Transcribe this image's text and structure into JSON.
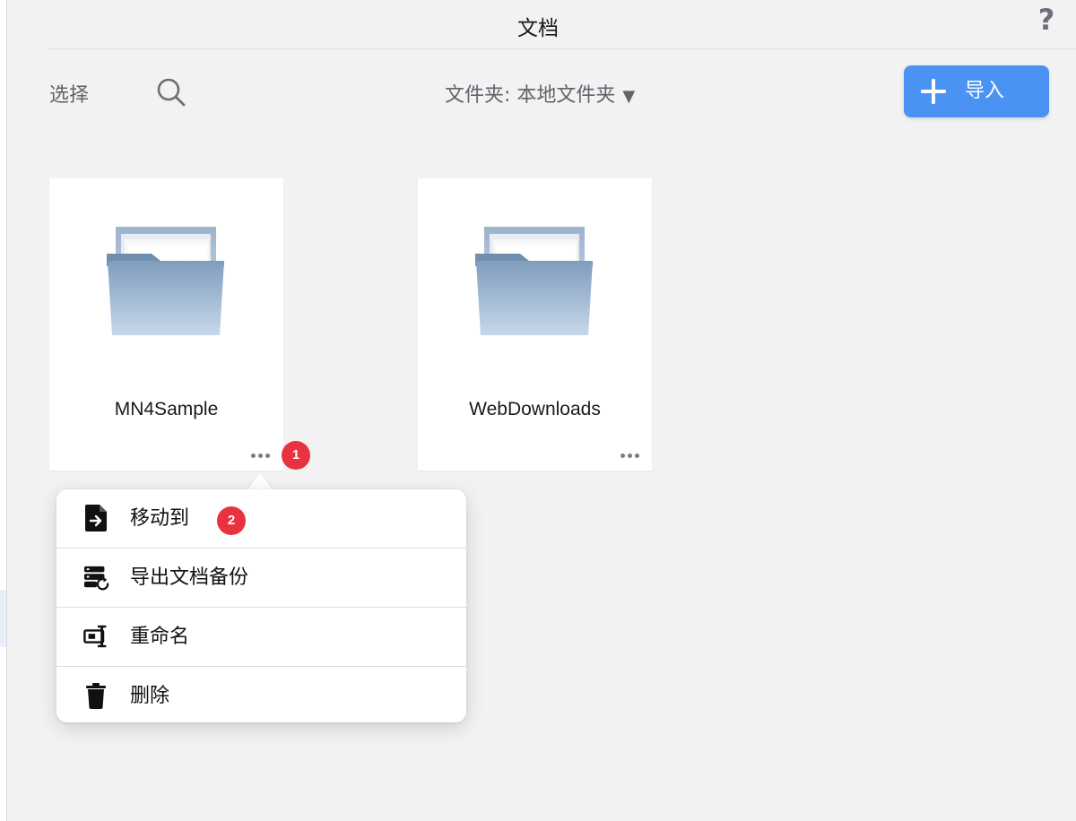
{
  "header": {
    "title": "文档",
    "help_label": "?"
  },
  "toolbar": {
    "select_label": "选择",
    "search_icon": "search-icon",
    "folder_prefix": "文件夹: ",
    "folder_value": "本地文件夹",
    "folder_caret": "▼",
    "import_label": "导入",
    "import_icon": "plus-icon",
    "accent_color": "#4a93f3"
  },
  "folders": [
    {
      "name": "MN4Sample",
      "icon": "folder-icon"
    },
    {
      "name": "WebDownloads",
      "icon": "folder-icon"
    }
  ],
  "badges": {
    "step1": "1",
    "step2": "2",
    "color": "#e9323f"
  },
  "context_menu": {
    "items": [
      {
        "label": "移动到",
        "icon": "move-to-icon"
      },
      {
        "label": "导出文档备份",
        "icon": "export-backup-icon"
      },
      {
        "label": "重命名",
        "icon": "rename-icon"
      },
      {
        "label": "删除",
        "icon": "trash-icon"
      }
    ]
  }
}
